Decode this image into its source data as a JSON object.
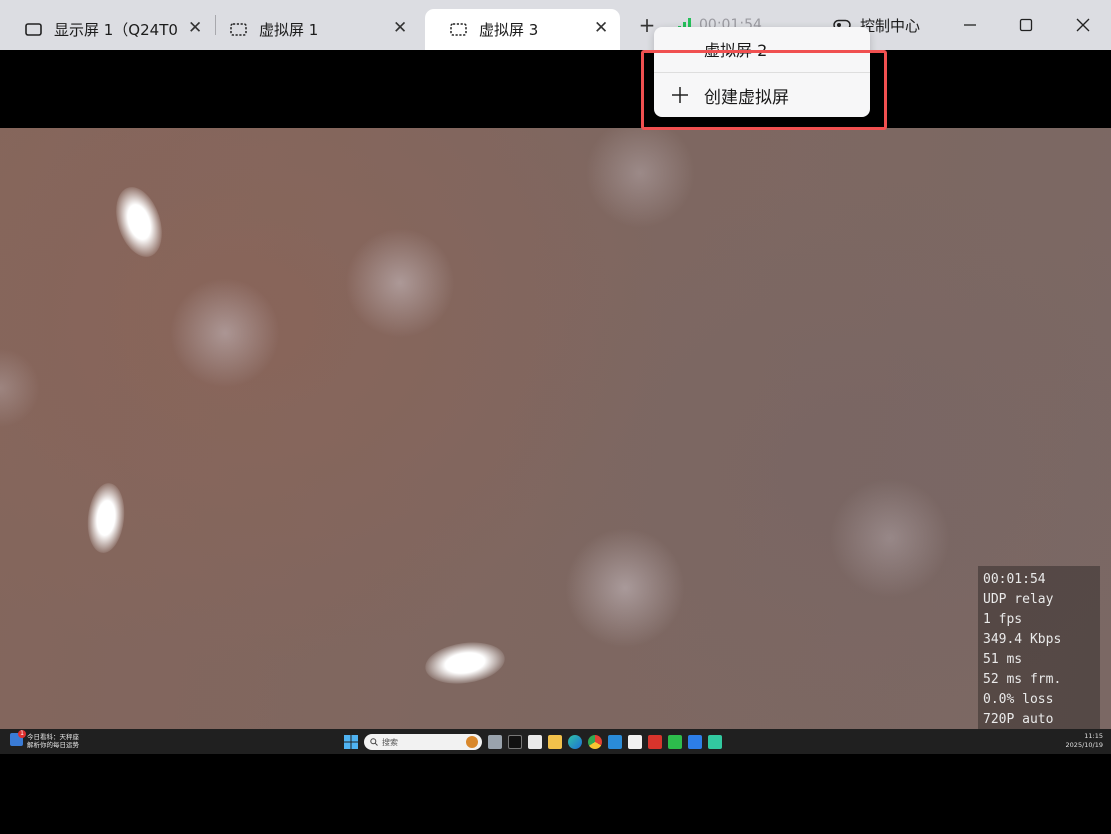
{
  "tabs": [
    {
      "label": "显示屏 1（Q24T0",
      "icon": "monitor-icon",
      "active": false
    },
    {
      "label": "虚拟屏 1",
      "icon": "virtual-screen-icon",
      "active": false
    },
    {
      "label": "虚拟屏 3",
      "icon": "virtual-screen-icon",
      "active": true
    }
  ],
  "close_glyph": "✕",
  "new_tab_glyph": "+",
  "session_timer": "00:01:54",
  "control_center_label": "控制中心",
  "window_controls": [
    "minimize-icon",
    "maximize-icon",
    "close-icon"
  ],
  "dropdown": {
    "items": [
      "虚拟屏 2"
    ],
    "create_label": "创建虚拟屏"
  },
  "stats": [
    "00:01:54",
    "UDP relay",
    "1 fps",
    "349.4 Kbps",
    "51 ms",
    "52 ms frm.",
    "0.0% loss",
    "720P auto"
  ],
  "remote_taskbar": {
    "news_badge": "1",
    "news_line1": "今日看科：天秤座",
    "news_line2": "解析你的每日运势",
    "search_placeholder": "搜索",
    "clock_time": "11:15",
    "clock_date": "2025/10/19"
  },
  "colors": {
    "titlebar_bg": "#dcdde2",
    "highlight_border": "#f05050",
    "signal_green": "#25c05a"
  }
}
